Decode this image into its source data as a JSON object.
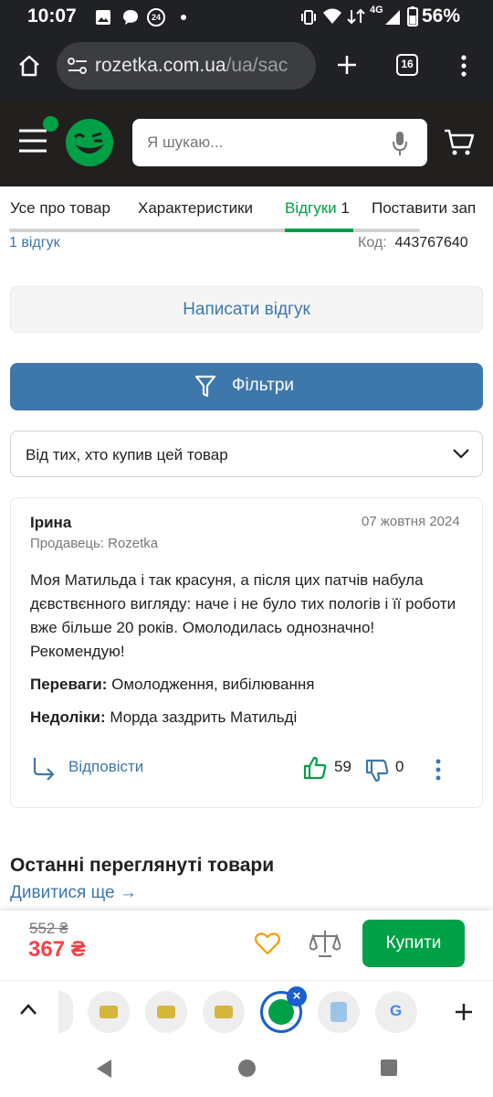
{
  "status_bar": {
    "time": "10:07",
    "battery": "56%",
    "notification_count": "24",
    "network": "4G"
  },
  "browser": {
    "url_main": "rozetka.com.ua",
    "url_rest": "/ua/sac",
    "tab_count": "16"
  },
  "header": {
    "search_placeholder": "Я шукаю..."
  },
  "tabs": [
    {
      "label": "Усе про товар"
    },
    {
      "label": "Характеристики"
    },
    {
      "label": "Відгуки",
      "count": "1"
    },
    {
      "label": "Поставити зап"
    }
  ],
  "meta": {
    "reviews_count_link": "1 відгук",
    "code_label": "Код:",
    "code_value": "443767640"
  },
  "actions": {
    "write_review": "Написати відгук",
    "filters": "Фільтри"
  },
  "filter_select": {
    "selected": "Від тих, хто купив цей товар"
  },
  "review": {
    "author": "Ірина",
    "date": "07 жовтня 2024",
    "seller": "Продавець: Rozetka",
    "text": "Моя Матильда і так красуня, а після цих патчів набула дєвствєнного вигляду: наче і не було тих пологів і її роботи вже більше 20 років. Омолодилась однозначно! Рекомендую!",
    "pros_label": "Переваги:",
    "pros": "Омолодження, вибілювання",
    "cons_label": "Недоліки:",
    "cons": "Морда заздрить Матильді",
    "reply_label": "Відповісти",
    "likes": "59",
    "dislikes": "0"
  },
  "recent": {
    "title": "Останні переглянуті товари",
    "see_more": "Дивитися ще →"
  },
  "buy_bar": {
    "old_price": "552 ₴",
    "new_price": "367 ₴",
    "buy_label": "Купити"
  },
  "colors": {
    "brand_green": "#00a046",
    "link_blue": "#3e77aa",
    "price_red": "#f84147",
    "header_dark": "#221f1f"
  }
}
